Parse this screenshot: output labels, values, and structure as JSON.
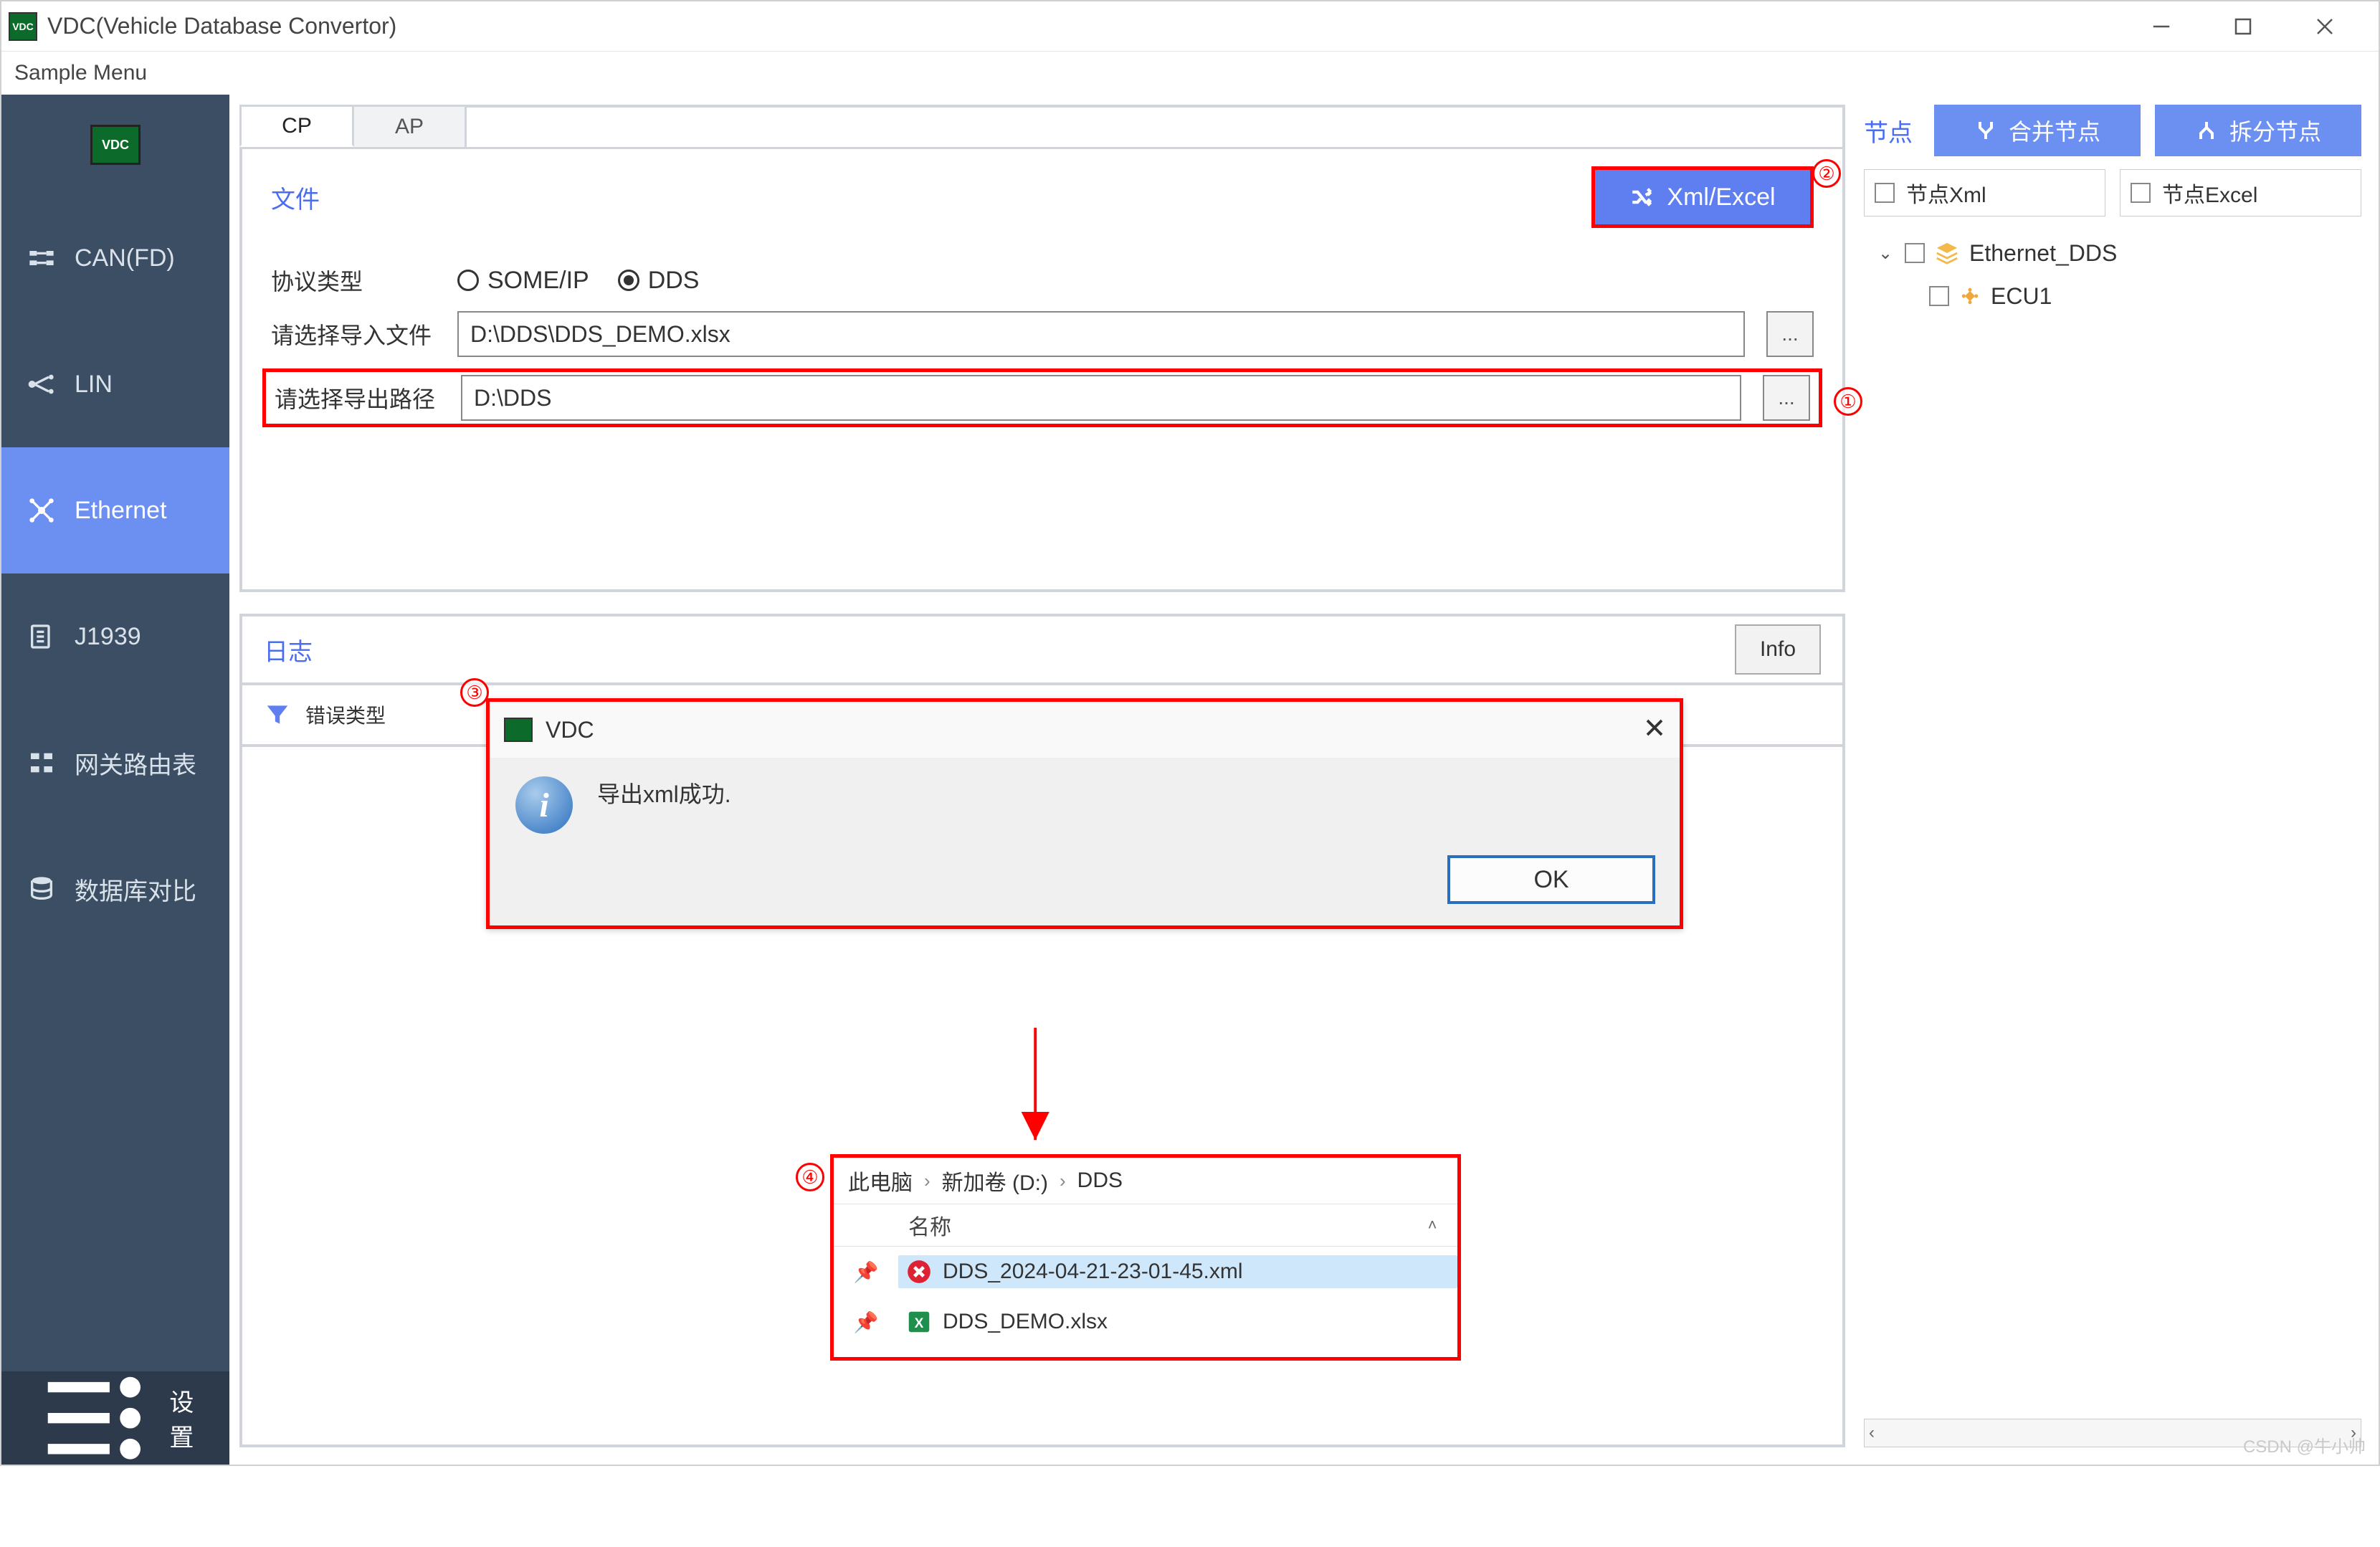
{
  "window": {
    "title": "VDC(Vehicle Database Convertor)"
  },
  "menu": {
    "sample": "Sample Menu"
  },
  "sidebar": {
    "brand": "VDC",
    "items": [
      {
        "label": "CAN(FD)"
      },
      {
        "label": "LIN"
      },
      {
        "label": "Ethernet"
      },
      {
        "label": "J1939"
      },
      {
        "label": "网关路由表"
      },
      {
        "label": "数据库对比"
      }
    ],
    "settings": "设置"
  },
  "tabs": {
    "cp": "CP",
    "ap": "AP"
  },
  "toppanel": {
    "file_label": "文件",
    "xml_button": "Xml/Excel",
    "protocol_label": "协议类型",
    "radio_someip": "SOME/IP",
    "radio_dds": "DDS",
    "import_label": "请选择导入文件",
    "import_value": "D:\\DDS\\DDS_DEMO.xlsx",
    "export_label": "请选择导出路径",
    "export_value": "D:\\DDS",
    "browse": "..."
  },
  "annotations": {
    "a1": "①",
    "a2": "②",
    "a3": "③",
    "a4": "④"
  },
  "log": {
    "title": "日志",
    "info_btn": "Info",
    "filter_label": "错误类型"
  },
  "dialog": {
    "title": "VDC",
    "message": "导出xml成功.",
    "ok": "OK"
  },
  "explorer": {
    "bc1": "此电脑",
    "bc2": "新加卷 (D:)",
    "bc3": "DDS",
    "col_name": "名称",
    "files": [
      {
        "name": "DDS_2024-04-21-23-01-45.xml",
        "selected": true,
        "type": "xml"
      },
      {
        "name": "DDS_DEMO.xlsx",
        "selected": false,
        "type": "xlsx"
      }
    ]
  },
  "right": {
    "node_label": "节点",
    "merge_btn": "合并节点",
    "split_btn": "拆分节点",
    "node_xml": "节点Xml",
    "node_excel": "节点Excel",
    "tree_root": "Ethernet_DDS",
    "tree_child": "ECU1"
  },
  "watermark": "CSDN @牛小帅"
}
